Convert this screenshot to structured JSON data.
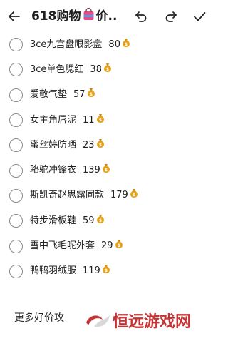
{
  "header": {
    "title_prefix": "618购物",
    "title_suffix": "价...",
    "back_icon": "back-arrow-icon",
    "undo_icon": "undo-icon",
    "redo_icon": "redo-icon",
    "confirm_icon": "check-icon"
  },
  "items": [
    {
      "name": "3ce九宫盘眼影盘",
      "price": "80",
      "checked": false
    },
    {
      "name": "3ce单色腮红",
      "price": "38",
      "checked": false
    },
    {
      "name": "爱敬气垫",
      "price": "57",
      "checked": false
    },
    {
      "name": "女主角唇泥",
      "price": "11",
      "checked": false
    },
    {
      "name": "蜜丝婷防晒",
      "price": "23",
      "checked": false
    },
    {
      "name": "骆驼冲锋衣",
      "price": "139",
      "checked": false
    },
    {
      "name": "斯凯奇赵思露同款",
      "price": "179",
      "checked": false
    },
    {
      "name": "特步滑板鞋",
      "price": "59",
      "checked": false
    },
    {
      "name": "雪中飞毛呢外套",
      "price": "29",
      "checked": false
    },
    {
      "name": "鸭鸭羽绒服",
      "price": "119",
      "checked": false
    }
  ],
  "footer": {
    "more_text": "更多好价攻",
    "watermark": "恒远游戏网"
  },
  "colors": {
    "money_bag": "#e5a11a",
    "shopping_bag": "#e84b8a",
    "watermark": "#c43434"
  }
}
